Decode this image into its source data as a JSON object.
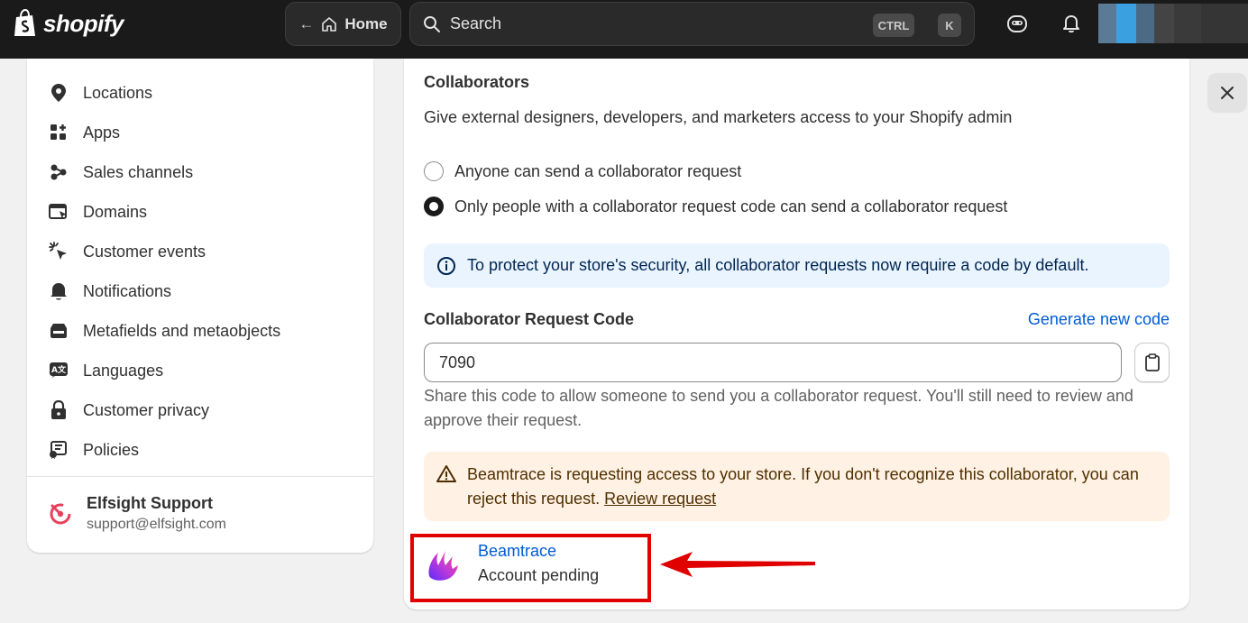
{
  "topbar": {
    "brand": "shopify",
    "home_label": "Home",
    "search_placeholder": "Search",
    "shortcut_ctrl": "CTRL",
    "shortcut_k": "K"
  },
  "sidebar": {
    "items": [
      {
        "label": "Locations",
        "icon": "location-pin-icon"
      },
      {
        "label": "Apps",
        "icon": "apps-icon"
      },
      {
        "label": "Sales channels",
        "icon": "sales-channels-icon"
      },
      {
        "label": "Domains",
        "icon": "domains-icon"
      },
      {
        "label": "Customer events",
        "icon": "cursor-click-icon"
      },
      {
        "label": "Notifications",
        "icon": "bell-icon"
      },
      {
        "label": "Metafields and metaobjects",
        "icon": "metafields-icon"
      },
      {
        "label": "Languages",
        "icon": "translate-icon"
      },
      {
        "label": "Customer privacy",
        "icon": "lock-icon"
      },
      {
        "label": "Policies",
        "icon": "policy-icon"
      }
    ],
    "account": {
      "name": "Elfsight Support",
      "email": "support@elfsight.com"
    }
  },
  "collaborators": {
    "title": "Collaborators",
    "description": "Give external designers, developers, and marketers access to your Shopify admin",
    "options": [
      {
        "label": "Anyone can send a collaborator request",
        "checked": false
      },
      {
        "label": "Only people with a collaborator request code can send a collaborator request",
        "checked": true
      }
    ],
    "info_banner": "To protect your store's security, all collaborator requests now require a code by default.",
    "code_label": "Collaborator Request Code",
    "generate_link": "Generate new code",
    "code_value": "7090",
    "help_text": "Share this code to allow someone to send you a collaborator request. You'll still need to review and approve their request.",
    "warning_text": "Beamtrace is requesting access to your store. If you don't recognize this collaborator, you can reject this request.",
    "review_link": "Review request",
    "collaborator": {
      "name": "Beamtrace",
      "status": "Account pending"
    }
  },
  "colors": {
    "topbar": "#1a1a1a",
    "link": "#005bd3",
    "info_bg": "#eaf4ff",
    "warning_bg": "#fff1e3",
    "annotation_red": "#e00000"
  }
}
